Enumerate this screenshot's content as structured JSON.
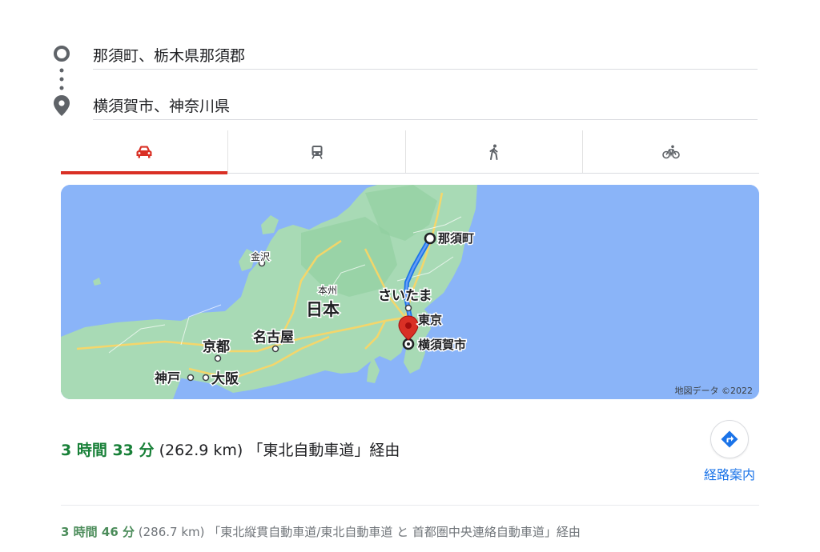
{
  "route": {
    "origin": "那須町、栃木県那須郡",
    "destination": "横須賀市、神奈川県"
  },
  "tabs": [
    {
      "id": "car",
      "icon": "car-icon",
      "active": true
    },
    {
      "id": "transit",
      "icon": "train-icon",
      "active": false
    },
    {
      "id": "walk",
      "icon": "walking-icon",
      "active": false
    },
    {
      "id": "bike",
      "icon": "bicycle-icon",
      "active": false
    }
  ],
  "map": {
    "labels": {
      "nasu": "那須町",
      "kanazawa": "金沢",
      "honshu": "本州",
      "nihon": "日本",
      "saitama": "さいたま",
      "tokyo": "東京",
      "nagoya": "名古屋",
      "kyoto": "京都",
      "yokosuka": "横須賀市",
      "kobe": "神戸",
      "osaka": "大阪"
    },
    "attribution": "地図データ ©2022",
    "colors": {
      "sea": "#8ab4f8",
      "land": "#a8dab5",
      "route": "#1a73e8",
      "pin": "#d93025",
      "road": "#fdd663"
    }
  },
  "primary": {
    "time": "3 時間 33 分",
    "distance": "(262.9 km)",
    "via": "「東北自動車道」経由"
  },
  "navigate": {
    "label": "経路案内",
    "icon": "turn-right-arrow-icon"
  },
  "alternative": {
    "time": "3 時間 46 分",
    "distance": "(286.7 km)",
    "via": "「東北縦貫自動車道/東北自動車道 と 首都圏中央連絡自動車道」経由"
  }
}
